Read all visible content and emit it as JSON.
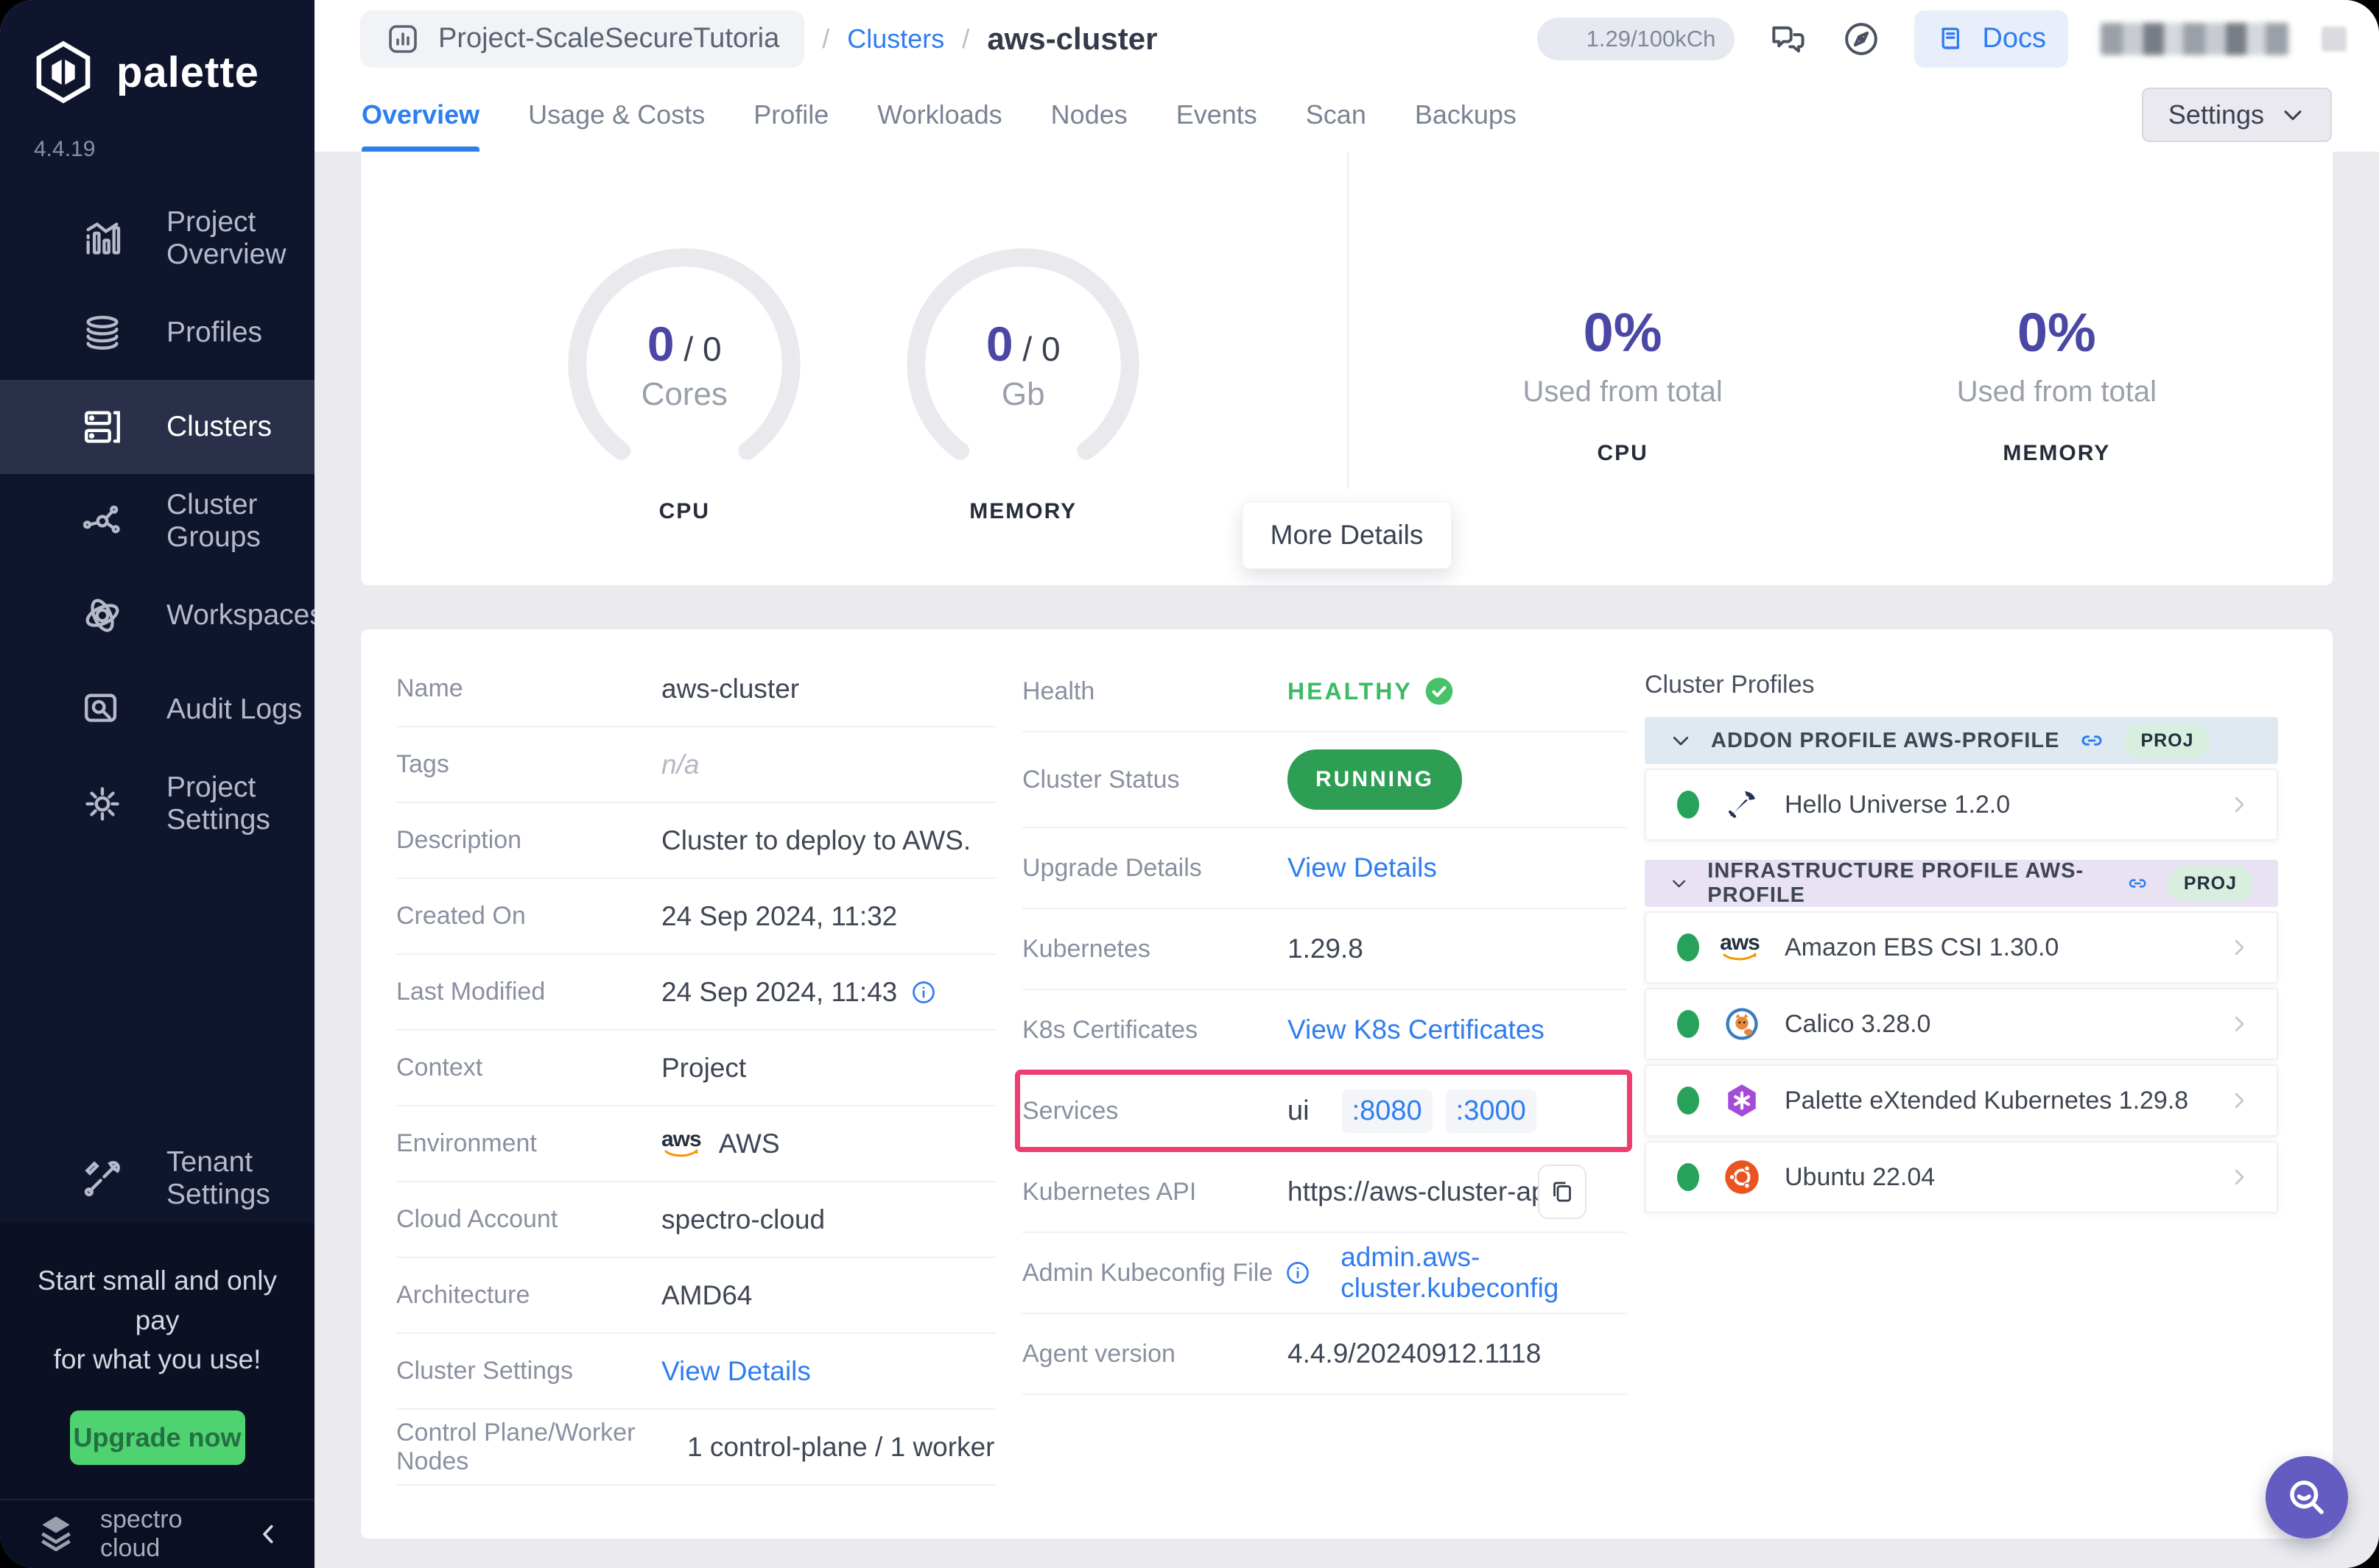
{
  "sidebar": {
    "brand": "palette",
    "version": "4.4.19",
    "items": [
      {
        "label": "Project Overview"
      },
      {
        "label": "Profiles"
      },
      {
        "label": "Clusters"
      },
      {
        "label": "Cluster Groups"
      },
      {
        "label": "Workspaces"
      },
      {
        "label": "Audit Logs"
      },
      {
        "label": "Project Settings"
      }
    ],
    "selected": "Clusters",
    "tenant": "Tenant Settings",
    "promo_line1": "Start small and only pay",
    "promo_line2": "for what you use!",
    "upgrade_button": "Upgrade now",
    "footer_brand": "spectro cloud"
  },
  "header": {
    "project": "Project-ScaleSecureTutoria",
    "sep": "/",
    "clusters_link": "Clusters",
    "cluster_name": "aws-cluster",
    "credits": "1.29/100kCh",
    "docs": "Docs"
  },
  "tabs": {
    "items": [
      "Overview",
      "Usage & Costs",
      "Profile",
      "Workloads",
      "Nodes",
      "Events",
      "Scan",
      "Backups"
    ],
    "active": "Overview",
    "settings": "Settings"
  },
  "usage": {
    "cpu": {
      "used": "0",
      "sep": "/ 0",
      "unit": "Cores",
      "label": "CPU"
    },
    "memory": {
      "used": "0",
      "sep": "/ 0",
      "unit": "Gb",
      "label": "MEMORY"
    },
    "cpu_pct": "0%",
    "memory_pct": "0%",
    "used_from_total": "Used from total",
    "pct_cpu_label": "CPU",
    "pct_memory_label": "MEMORY",
    "more_details": "More Details"
  },
  "overview": {
    "name": {
      "label": "Name",
      "value": "aws-cluster"
    },
    "tags": {
      "label": "Tags",
      "value": "n/a"
    },
    "description": {
      "label": "Description",
      "value": "Cluster to deploy to AWS."
    },
    "created": {
      "label": "Created On",
      "value": "24 Sep 2024, 11:32"
    },
    "modified": {
      "label": "Last Modified",
      "value": "24 Sep 2024, 11:43"
    },
    "context": {
      "label": "Context",
      "value": "Project"
    },
    "environment": {
      "label": "Environment",
      "value": "AWS",
      "aws_logo_text": "aws"
    },
    "cloud": {
      "label": "Cloud Account",
      "value": "spectro-cloud"
    },
    "arch": {
      "label": "Architecture",
      "value": "AMD64"
    },
    "settings": {
      "label": "Cluster Settings",
      "link": "View Details"
    },
    "nodes": {
      "label": "Control Plane/Worker Nodes",
      "value": "1 control-plane / 1 worker"
    }
  },
  "cluster_info": {
    "health": {
      "label": "Health",
      "value": "HEALTHY"
    },
    "status": {
      "label": "Cluster Status",
      "value": "RUNNING"
    },
    "upgrade": {
      "label": "Upgrade Details",
      "link": "View Details"
    },
    "kubernetes": {
      "label": "Kubernetes",
      "value": "1.29.8"
    },
    "certs": {
      "label": "K8s Certificates",
      "link": "View K8s Certificates"
    },
    "services": {
      "label": "Services",
      "name": "ui",
      "ports": [
        ":8080",
        ":3000"
      ]
    },
    "api": {
      "label": "Kubernetes API",
      "value": "https://aws-cluster-apiserve..."
    },
    "kubeconfig": {
      "label": "Admin Kubeconfig File",
      "link": "admin.aws-cluster.kubeconfig"
    },
    "agent": {
      "label": "Agent version",
      "value": "4.4.9/20240912.1118"
    }
  },
  "profiles": {
    "title": "Cluster Profiles",
    "groups": [
      {
        "name": "ADDON PROFILE AWS-PROFILE",
        "badge": "PROJ",
        "items": [
          {
            "name": "Hello Universe 1.2.0"
          }
        ]
      },
      {
        "name": "INFRASTRUCTURE PROFILE AWS-PROFILE",
        "badge": "PROJ",
        "items": [
          {
            "name": "Amazon EBS CSI 1.30.0",
            "aws_logo_text": "aws"
          },
          {
            "name": "Calico 3.28.0"
          },
          {
            "name": "Palette eXtended Kubernetes 1.29.8"
          },
          {
            "name": "Ubuntu 22.04"
          }
        ]
      }
    ]
  },
  "colors": {
    "accent_blue": "#2f7df0",
    "accent_purple": "#4b47a5",
    "running_green": "#2d9e53",
    "healthy_green": "#3cba64",
    "highlight_pink": "#ee3d6e",
    "upgrade_green": "#4fd371",
    "sidebar_bg": "#10152e"
  }
}
